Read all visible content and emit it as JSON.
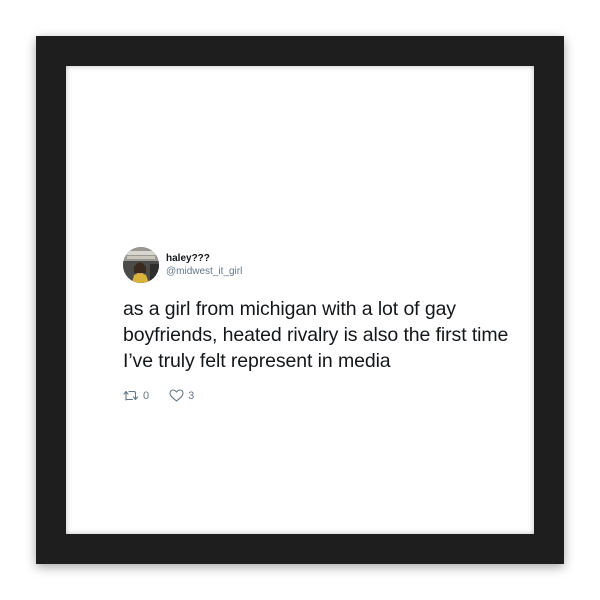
{
  "tweet": {
    "display_name": "haley???",
    "handle": "@midwest_it_girl",
    "text": "as a girl from michigan with a lot of gay boyfriends, heated rivalry is also the first time I’ve truly felt represent in media",
    "retweet_count": "0",
    "like_count": "3"
  },
  "icons": {
    "retweet": "retweet-icon",
    "like": "heart-icon"
  },
  "colors": {
    "frame": "#1e1e1e",
    "text": "#14171a",
    "secondary": "#657786"
  }
}
